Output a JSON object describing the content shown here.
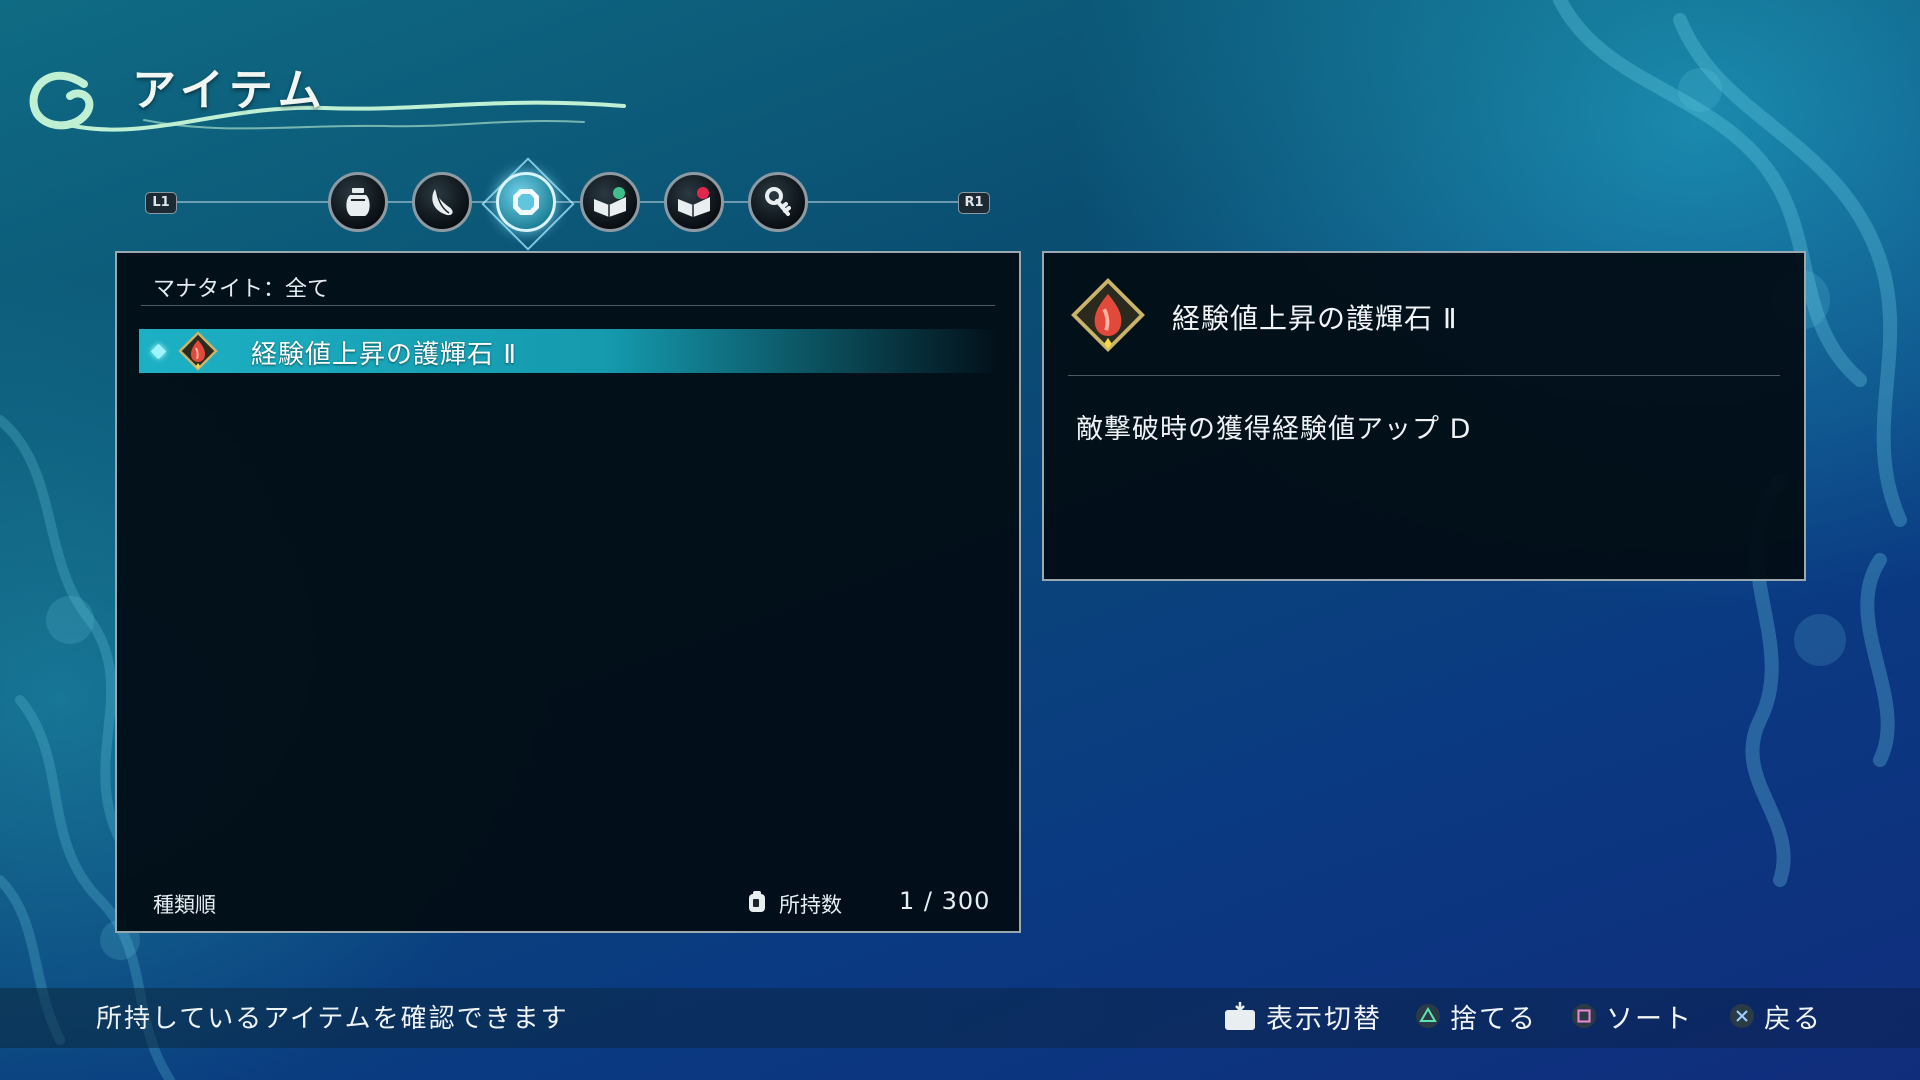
{
  "title": "アイテム",
  "category_bar": {
    "left_button": "L1",
    "right_button": "R1",
    "tabs": [
      {
        "icon": "potion-jar-icon",
        "active": false
      },
      {
        "icon": "feather-icon",
        "active": false
      },
      {
        "icon": "manatite-gem-icon",
        "active": true
      },
      {
        "icon": "green-book-icon",
        "active": false
      },
      {
        "icon": "red-book-icon",
        "active": false
      },
      {
        "icon": "key-icon",
        "active": false
      }
    ]
  },
  "list": {
    "header": "マナタイト：全て",
    "items": [
      {
        "name": "経験値上昇の護輝石 Ⅱ",
        "icon": "red-gem-icon",
        "selected": true
      }
    ],
    "sort_label": "種類順",
    "count_label": "所持数",
    "count_value": "1 / 300"
  },
  "detail": {
    "name": "経験値上昇の護輝石 Ⅱ",
    "icon": "red-gem-icon",
    "description": "敵撃破時の獲得経験値アップ D"
  },
  "footer": {
    "hint": "所持しているアイテムを確認できます",
    "actions": [
      {
        "glyph": "touchpad-icon",
        "label": "表示切替"
      },
      {
        "glyph": "triangle-icon",
        "label": "捨てる"
      },
      {
        "glyph": "square-icon",
        "label": "ソート"
      },
      {
        "glyph": "cross-icon",
        "label": "戻る"
      }
    ]
  },
  "colors": {
    "accent": "#1db0c4",
    "panel_bg": "#02101a",
    "panel_border": "#9aa8b0"
  }
}
